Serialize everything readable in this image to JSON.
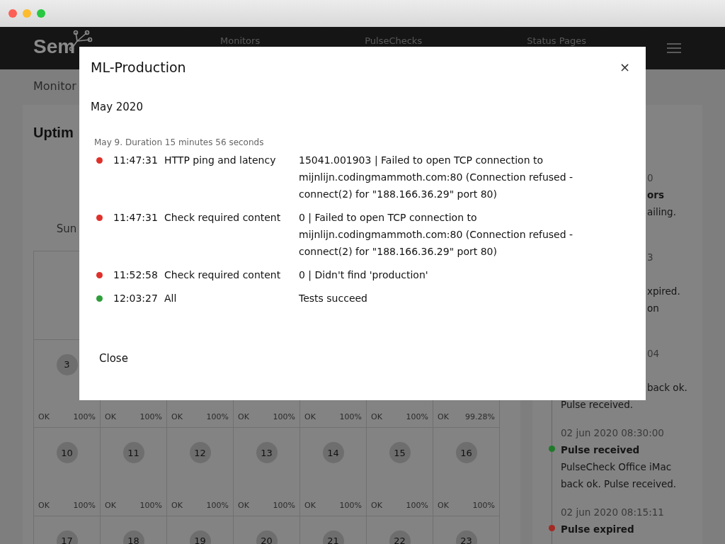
{
  "header": {
    "logo": "Sem",
    "nav": [
      "Monitors",
      "PulseChecks",
      "Status Pages"
    ]
  },
  "breadcrumb": "Monitor",
  "uptime": {
    "title": "Uptim",
    "weekdays": [
      "Sun"
    ],
    "weeks": [
      {
        "cells": [
          {}
        ]
      },
      {
        "cells": [
          {
            "day": "3",
            "status": "OK",
            "percent": "100%"
          },
          {
            "status": "OK",
            "percent": "100%"
          },
          {
            "status": "OK",
            "percent": "100%"
          },
          {
            "status": "OK",
            "percent": "100%"
          },
          {
            "status": "OK",
            "percent": "100%"
          },
          {
            "status": "OK",
            "percent": "100%"
          },
          {
            "status": "OK",
            "percent": "99.28%"
          }
        ]
      },
      {
        "cells": [
          {
            "day": "10",
            "status": "OK",
            "percent": "100%"
          },
          {
            "day": "11",
            "status": "OK",
            "percent": "100%"
          },
          {
            "day": "12",
            "status": "OK",
            "percent": "100%"
          },
          {
            "day": "13",
            "status": "OK",
            "percent": "100%"
          },
          {
            "day": "14",
            "status": "OK",
            "percent": "100%"
          },
          {
            "day": "15",
            "status": "OK",
            "percent": "100%"
          },
          {
            "day": "16",
            "status": "OK",
            "percent": "100%"
          }
        ]
      },
      {
        "cells": [
          {
            "day": "17"
          },
          {
            "day": "18"
          },
          {
            "day": "19"
          },
          {
            "day": "20"
          },
          {
            "day": "21"
          },
          {
            "day": "22"
          },
          {
            "day": "23"
          }
        ]
      }
    ]
  },
  "events": [
    {
      "time": "0",
      "title": "ors",
      "lines": [
        "ailing."
      ]
    },
    {
      "time": "3",
      "lines": [
        "xpired.",
        "on"
      ]
    },
    {
      "time": "04",
      "lines": [
        "back ok."
      ],
      "full_lines": [
        "Pulse received."
      ]
    },
    {
      "time": "02 jun 2020 08:30:00",
      "title": "Pulse received",
      "color": "#1f7a2a",
      "full_lines": [
        "PulseCheck Office iMac",
        "back ok. Pulse received."
      ]
    },
    {
      "time": "02 jun 2020 08:15:11",
      "title": "Pulse expired",
      "color": "#a32a22"
    }
  ],
  "modal": {
    "title": "ML-Production",
    "close_icon": "×",
    "month": "May 2020",
    "group": "May 9. Duration 15 minutes 56 seconds",
    "results": [
      {
        "color": "#e0302a",
        "time": "11:47:31",
        "check": "HTTP ping and latency",
        "message": "15041.001903 | Failed to open TCP connection to mijnlijn.codingmammoth.com:80 (Connection refused - connect(2) for \"188.166.36.29\" port 80)"
      },
      {
        "color": "#e0302a",
        "time": "11:47:31",
        "check": "Check required content",
        "message": "0 | Failed to open TCP connection to mijnlijn.codingmammoth.com:80 (Connection refused - connect(2) for \"188.166.36.29\" port 80)"
      },
      {
        "color": "#e0302a",
        "time": "11:52:58",
        "check": "Check required content",
        "message": "0 | Didn't find 'production'"
      },
      {
        "color": "#2e9e3a",
        "time": "12:03:27",
        "check": "All",
        "message": "Tests succeed"
      }
    ],
    "button": "Close"
  }
}
